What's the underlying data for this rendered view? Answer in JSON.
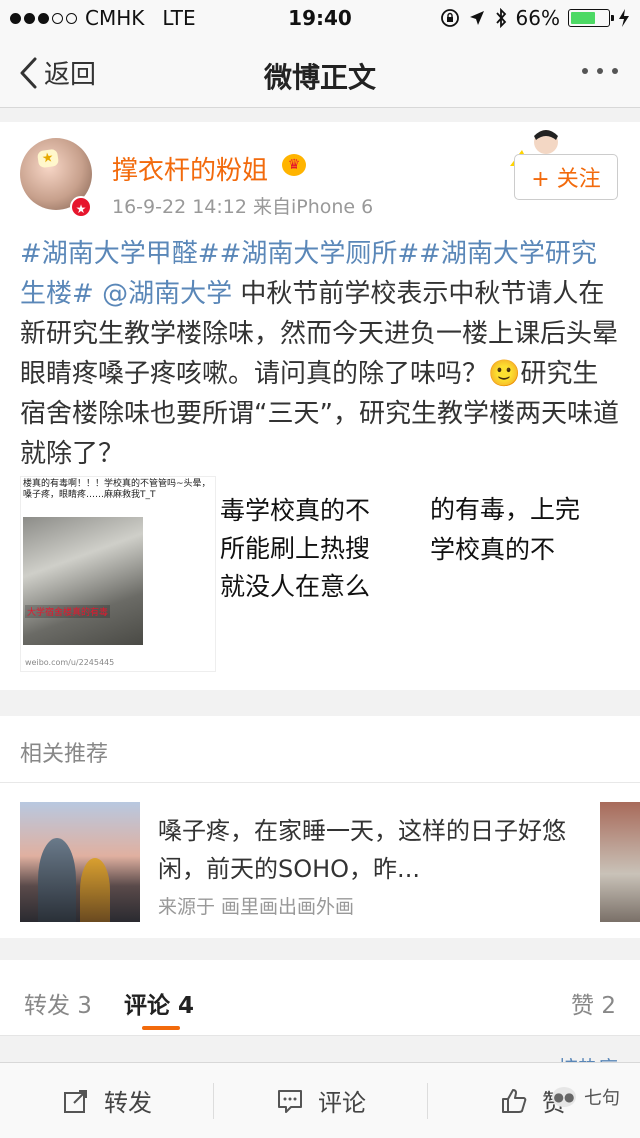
{
  "status_bar": {
    "carrier": "CMHK",
    "network": "LTE",
    "time": "19:40",
    "battery_percent": "66%",
    "battery_level": 0.66,
    "signal_bars_filled": 3,
    "signal_bars_total": 5,
    "battery_color": "#4cd964"
  },
  "nav": {
    "back_label": "返回",
    "title": "微博正文"
  },
  "post": {
    "author": "撑衣杆的粉姐",
    "meta": "16-9-22 14:12  来自iPhone 6",
    "follow_label": "+ 关注",
    "hashtags": "#湖南大学甲醛##湖南大学厕所##湖南大学研究生楼#",
    "mention": "@湖南大学",
    "body_1": " 中秋节前学校表示中秋节请人在新研究生教学楼除味，然而今天进负一楼上课后头晕眼睛疼嗓子疼咳嗽。请问真的除了味吗？",
    "emoji": "🙂",
    "body_2": "研究生宿舍楼除味也要所谓“三天”，研究生教学楼两天味道就除了？",
    "accent_color": "#f26a0c",
    "link_color": "#5a87b8",
    "images": {
      "img1_caption": "楼真的有毒啊！！！学校真的不管管吗~头晕，嗓子疼，眼睛疼……麻麻救我T_T",
      "img1_sticker": "大学宿舍楼真的有毒",
      "img1_footer": "weibo.com/u/2245445",
      "img2_lines": [
        "毒学校真的不",
        "所能刷上热搜",
        "就没人在意么"
      ],
      "img3_lines": [
        "的有毒，上完",
        "学校真的不"
      ]
    }
  },
  "related": {
    "title": "相关推荐",
    "text": "嗓子疼，在家睡一天，这样的日子好悠闲，前天的SOHO，昨...",
    "source": "来源于 画里画出画外画"
  },
  "tabs": {
    "repost": "转发 3",
    "comment": "评论 4",
    "like": "赞 2"
  },
  "sort_hint": "按热度",
  "toolbar": {
    "repost": "转发",
    "comment": "评论",
    "like": "赞"
  },
  "watermark": "七句"
}
